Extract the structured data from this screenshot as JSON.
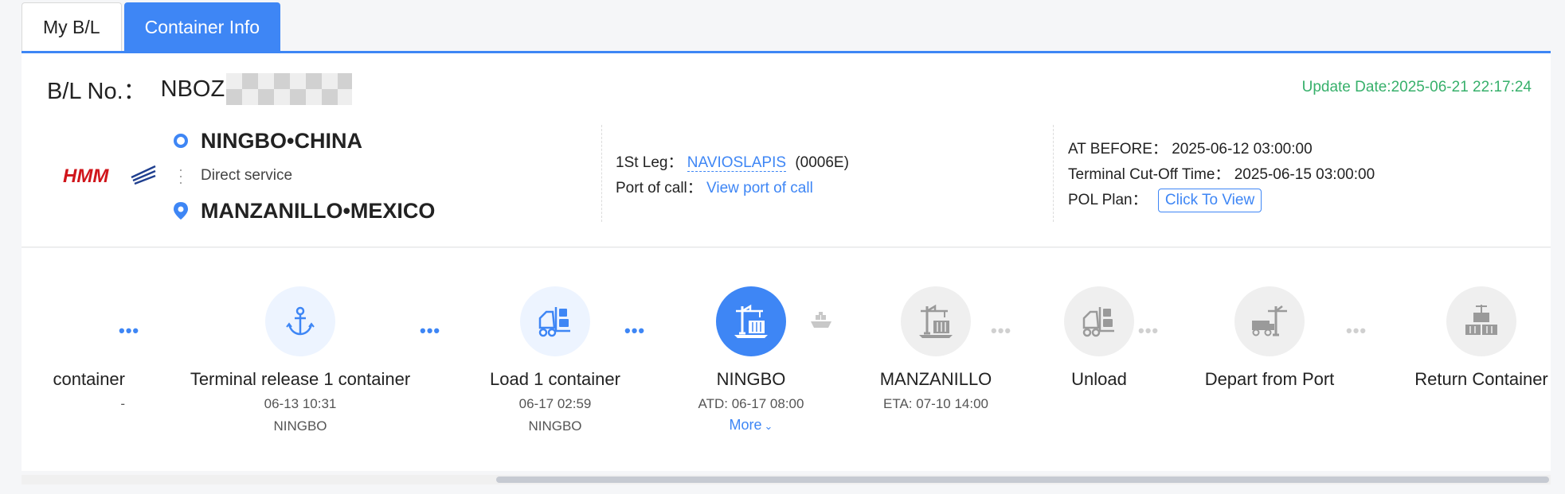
{
  "tabs": [
    {
      "label": "My B/L",
      "active": false
    },
    {
      "label": "Container Info",
      "active": true
    }
  ],
  "bl": {
    "label": "B/L No.：",
    "value_visible": "NBOZ",
    "update": "Update Date:2025-06-21 22:17:24"
  },
  "carrier": {
    "logo_text": "HMM"
  },
  "route": {
    "origin": "NINGBO•CHINA",
    "service": "Direct service",
    "destination": "MANZANILLO•MEXICO"
  },
  "leg": {
    "label": "1St Leg：",
    "vessel": "NAVIOSLAPIS",
    "voyage": "(0006E)",
    "port_call_label": "Port of call：",
    "port_call_link": "View port of call"
  },
  "cutoff": {
    "at_before_label": "AT BEFORE：",
    "at_before_value": "2025-06-12 03:00:00",
    "terminal_label": "Terminal Cut-Off Time：",
    "terminal_value": "2025-06-15 03:00:00",
    "pol_label": "POL Plan：",
    "pol_button": "Click To View"
  },
  "timeline": [
    {
      "label": "container",
      "date": "-",
      "place": "",
      "status": "done"
    },
    {
      "label": "Terminal release 1 container",
      "date": "06-13 10:31",
      "place": "NINGBO",
      "status": "done"
    },
    {
      "label": "Load 1 container",
      "date": "06-17 02:59",
      "place": "NINGBO",
      "status": "done"
    },
    {
      "label": "NINGBO",
      "date": "ATD: 06-17 08:00",
      "place": "",
      "more": "More",
      "status": "current"
    },
    {
      "label": "MANZANILLO",
      "date": "ETA: 07-10 14:00",
      "place": "",
      "status": "todo"
    },
    {
      "label": "Unload",
      "date": "",
      "place": "",
      "status": "todo"
    },
    {
      "label": "Depart from Port",
      "date": "",
      "place": "",
      "status": "todo"
    },
    {
      "label": "Return Container",
      "date": "",
      "place": "",
      "status": "todo"
    }
  ],
  "colors": {
    "accent": "#3e86f5",
    "update": "#37b06b"
  },
  "scroll": {
    "position": 0.6
  }
}
